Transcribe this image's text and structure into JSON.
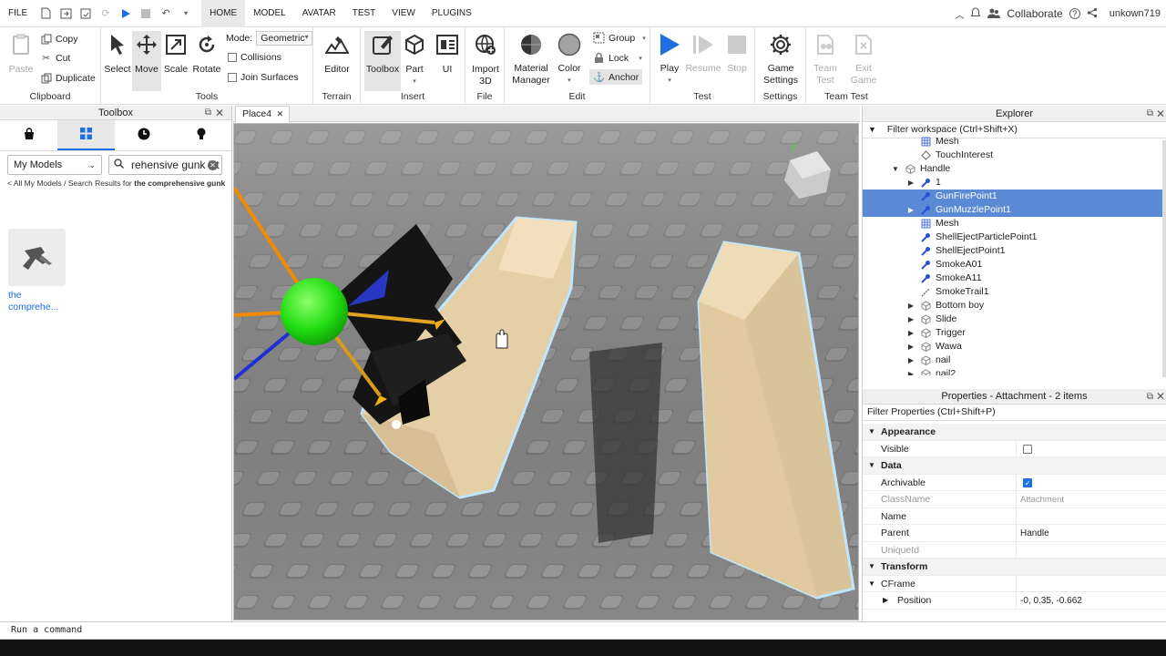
{
  "menubar": {
    "file": "FILE",
    "tabs": [
      "HOME",
      "MODEL",
      "AVATAR",
      "TEST",
      "VIEW",
      "PLUGINS"
    ],
    "active_tab": "HOME",
    "collaborate": "Collaborate",
    "username": "unkown719"
  },
  "ribbon": {
    "clipboard": {
      "paste": "Paste",
      "copy": "Copy",
      "cut": "Cut",
      "duplicate": "Duplicate",
      "label": "Clipboard"
    },
    "tools": {
      "select": "Select",
      "move": "Move",
      "scale": "Scale",
      "rotate": "Rotate",
      "mode_label": "Mode:",
      "mode_value": "Geometric",
      "collisions": "Collisions",
      "join_surfaces": "Join Surfaces",
      "label": "Tools"
    },
    "terrain": {
      "editor": "Editor",
      "label": "Terrain"
    },
    "insert": {
      "toolbox": "Toolbox",
      "part": "Part",
      "ui": "UI",
      "label": "Insert"
    },
    "file": {
      "import3d_1": "Import",
      "import3d_2": "3D",
      "label": "File"
    },
    "edit": {
      "material_1": "Material",
      "material_2": "Manager",
      "color": "Color",
      "group": "Group",
      "lock": "Lock",
      "anchor": "Anchor",
      "label": "Edit"
    },
    "test": {
      "play": "Play",
      "resume": "Resume",
      "stop": "Stop",
      "label": "Test"
    },
    "settings": {
      "game_1": "Game",
      "game_2": "Settings",
      "label": "Settings"
    },
    "team_test": {
      "team_1": "Team",
      "team_2": "Test",
      "exit_1": "Exit",
      "exit_2": "Game",
      "label": "Team Test"
    }
  },
  "toolbox": {
    "title": "Toolbox",
    "category": "My Models",
    "search_value": "rehensive gunk kit",
    "breadcrumb_prefix": "< All My Models / Search Results for ",
    "breadcrumb_query": "the comprehensive gunk",
    "item_label_1": "the",
    "item_label_2": "comprehe..."
  },
  "viewport": {
    "tab_label": "Place4"
  },
  "explorer": {
    "title": "Explorer",
    "filter_placeholder": "Filter workspace (Ctrl+Shift+X)",
    "rows": [
      {
        "label": "Mesh",
        "depth": 4,
        "arrow": "",
        "icon": "mesh-icon",
        "selected": false
      },
      {
        "label": "TouchInterest",
        "depth": 4,
        "arrow": "",
        "icon": "touchinterest-icon",
        "selected": false
      },
      {
        "label": "Handle",
        "depth": 3,
        "arrow": "▼",
        "icon": "part-icon",
        "selected": false
      },
      {
        "label": "1",
        "depth": 4,
        "arrow": "▶",
        "icon": "attachment-icon",
        "selected": false
      },
      {
        "label": "GunFirePoint1",
        "depth": 4,
        "arrow": "",
        "icon": "attachment-icon",
        "selected": true
      },
      {
        "label": "GunMuzzlePoint1",
        "depth": 4,
        "arrow": "▶",
        "icon": "attachment-icon",
        "selected": true
      },
      {
        "label": "Mesh",
        "depth": 4,
        "arrow": "",
        "icon": "mesh-icon",
        "selected": false
      },
      {
        "label": "ShellEjectParticlePoint1",
        "depth": 4,
        "arrow": "",
        "icon": "attachment-icon",
        "selected": false
      },
      {
        "label": "ShellEjectPoint1",
        "depth": 4,
        "arrow": "",
        "icon": "attachment-icon",
        "selected": false
      },
      {
        "label": "SmokeA01",
        "depth": 4,
        "arrow": "",
        "icon": "attachment-icon",
        "selected": false
      },
      {
        "label": "SmokeA11",
        "depth": 4,
        "arrow": "",
        "icon": "attachment-icon",
        "selected": false
      },
      {
        "label": "SmokeTrail1",
        "depth": 4,
        "arrow": "",
        "icon": "trail-icon",
        "selected": false
      },
      {
        "label": "Bottom boy",
        "depth": 4,
        "arrow": "▶",
        "icon": "part-icon",
        "selected": false
      },
      {
        "label": "Slide",
        "depth": 4,
        "arrow": "▶",
        "icon": "part-icon",
        "selected": false
      },
      {
        "label": "Trigger",
        "depth": 4,
        "arrow": "▶",
        "icon": "part-icon",
        "selected": false
      },
      {
        "label": "Wawa",
        "depth": 4,
        "arrow": "▶",
        "icon": "part-icon",
        "selected": false
      },
      {
        "label": "nail",
        "depth": 4,
        "arrow": "▶",
        "icon": "part-icon",
        "selected": false
      },
      {
        "label": "nail2",
        "depth": 4,
        "arrow": "▶",
        "icon": "part-icon",
        "selected": false
      }
    ]
  },
  "properties": {
    "title": "Properties - Attachment - 2 items",
    "filter_placeholder": "Filter Properties (Ctrl+Shift+P)",
    "rows": [
      {
        "type": "cat",
        "name": "Appearance"
      },
      {
        "type": "prop",
        "name": "Visible",
        "value": "",
        "checkbox": "unchecked"
      },
      {
        "type": "cat",
        "name": "Data"
      },
      {
        "type": "prop",
        "name": "Archivable",
        "value": "",
        "checkbox": "checked"
      },
      {
        "type": "prop",
        "name": "ClassName",
        "value": "Attachment",
        "muted": true
      },
      {
        "type": "prop",
        "name": "Name",
        "value": ""
      },
      {
        "type": "prop",
        "name": "Parent",
        "value": "Handle"
      },
      {
        "type": "prop",
        "name": "UniqueId",
        "value": "",
        "muted": true
      },
      {
        "type": "cat",
        "name": "Transform"
      },
      {
        "type": "cat2",
        "name": "CFrame"
      },
      {
        "type": "sub",
        "name": "Position",
        "value": "-0, 0.35, -0.662"
      }
    ]
  },
  "command_bar": {
    "placeholder": "Run a command"
  },
  "colors": {
    "selection": "#5a8ad6",
    "play_blue": "#1e6fe0",
    "block": "#e5cfa6",
    "outline": "#bfe6ff"
  }
}
